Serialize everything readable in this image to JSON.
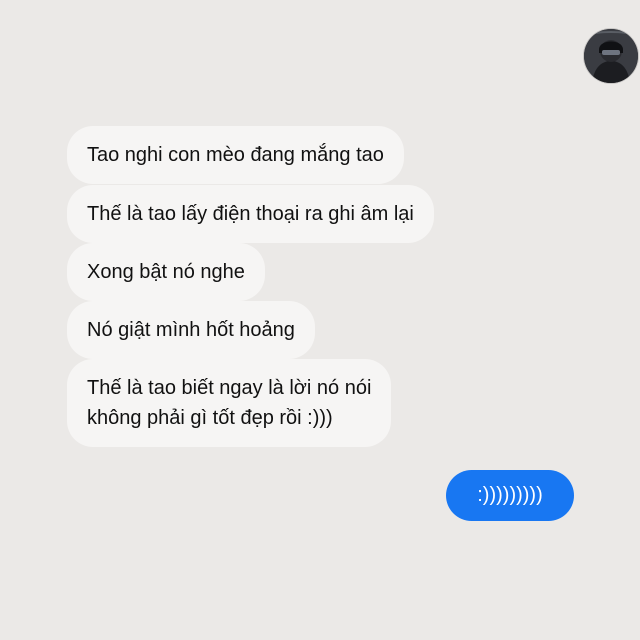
{
  "conversation": {
    "avatar_icon": "profile-avatar-icon",
    "incoming": [
      {
        "text": "Tao nghi con mèo đang mắng tao"
      },
      {
        "text": "Thế là tao lấy điện thoại ra ghi âm lại"
      },
      {
        "text": "Xong bật nó nghe"
      },
      {
        "text": "Nó giật mình hốt hoảng"
      },
      {
        "text": "Thế là tao biết ngay là lời nó nói\nkhông phải gì tốt đẹp rồi :)))"
      }
    ],
    "outgoing": [
      {
        "text": ":)))))))))"
      }
    ]
  },
  "colors": {
    "background": "#ebe9e7",
    "incoming_bubble": "#f6f5f4",
    "outgoing_bubble": "#1877f2",
    "outgoing_text": "#ffffff"
  }
}
